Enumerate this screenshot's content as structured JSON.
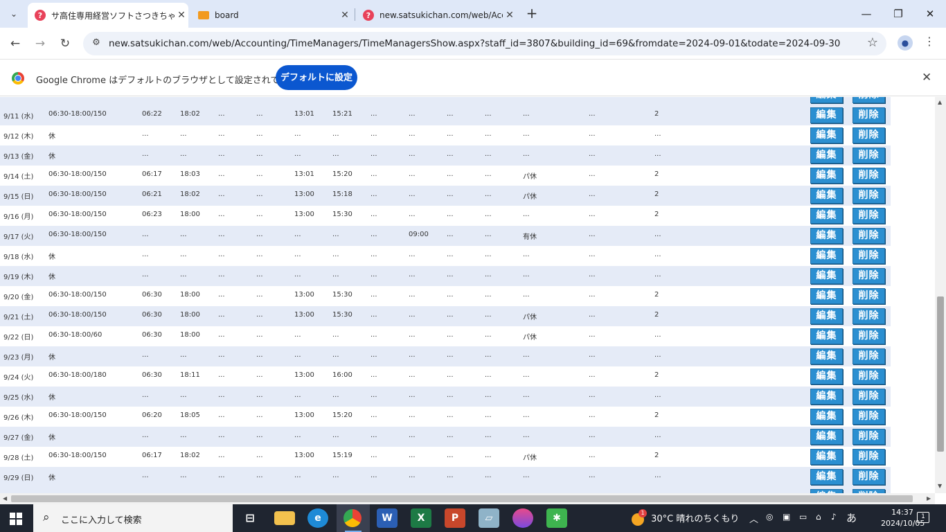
{
  "tabs": [
    {
      "title": "サ高住専用経営ソフトさつきちゃん",
      "favicon": "question-favicon",
      "active": true
    },
    {
      "title": "board",
      "favicon": "board-favicon",
      "active": false
    },
    {
      "title": "new.satsukichan.com/web/Acco",
      "favicon": "question-favicon",
      "active": false
    }
  ],
  "address_bar": {
    "url": "new.satsukichan.com/web/Accounting/TimeManagers/TimeManagersShow.aspx?staff_id=3807&building_id=69&fromdate=2024-09-01&todate=2024-09-30"
  },
  "infobar": {
    "message": "Google Chrome はデフォルトのブラウザとして設定されていません",
    "button_label": "デフォルトに設定"
  },
  "row_buttons": {
    "edit": "編集",
    "delete": "削除"
  },
  "rows": [
    {
      "date": "9/11 (水)",
      "shift": "06:30-18:00/150",
      "in": "06:22",
      "out": "18:02",
      "c4": "...",
      "c5": "...",
      "brk_out": "13:01",
      "brk_in": "15:21",
      "c8": "...",
      "c9": "...",
      "c10": "...",
      "c11": "...",
      "leave": "...",
      "c13": "...",
      "count": "2"
    },
    {
      "date": "9/12 (木)",
      "shift": "休",
      "in": "...",
      "out": "...",
      "c4": "...",
      "c5": "...",
      "brk_out": "...",
      "brk_in": "...",
      "c8": "...",
      "c9": "...",
      "c10": "...",
      "c11": "...",
      "leave": "...",
      "c13": "...",
      "count": "..."
    },
    {
      "date": "9/13 (金)",
      "shift": "休",
      "in": "...",
      "out": "...",
      "c4": "...",
      "c5": "...",
      "brk_out": "...",
      "brk_in": "...",
      "c8": "...",
      "c9": "...",
      "c10": "...",
      "c11": "...",
      "leave": "...",
      "c13": "...",
      "count": "..."
    },
    {
      "date": "9/14 (土)",
      "shift": "06:30-18:00/150",
      "in": "06:17",
      "out": "18:03",
      "c4": "...",
      "c5": "...",
      "brk_out": "13:01",
      "brk_in": "15:20",
      "c8": "...",
      "c9": "...",
      "c10": "...",
      "c11": "...",
      "leave": "パ休",
      "c13": "...",
      "count": "2"
    },
    {
      "date": "9/15 (日)",
      "shift": "06:30-18:00/150",
      "in": "06:21",
      "out": "18:02",
      "c4": "...",
      "c5": "...",
      "brk_out": "13:00",
      "brk_in": "15:18",
      "c8": "...",
      "c9": "...",
      "c10": "...",
      "c11": "...",
      "leave": "パ休",
      "c13": "...",
      "count": "2"
    },
    {
      "date": "9/16 (月)",
      "shift": "06:30-18:00/150",
      "in": "06:23",
      "out": "18:00",
      "c4": "...",
      "c5": "...",
      "brk_out": "13:00",
      "brk_in": "15:30",
      "c8": "...",
      "c9": "...",
      "c10": "...",
      "c11": "...",
      "leave": "...",
      "c13": "...",
      "count": "2"
    },
    {
      "date": "9/17 (火)",
      "shift": "06:30-18:00/150",
      "in": "...",
      "out": "...",
      "c4": "...",
      "c5": "...",
      "brk_out": "...",
      "brk_in": "...",
      "c8": "...",
      "c9": "09:00",
      "c10": "...",
      "c11": "...",
      "leave": "有休",
      "c13": "...",
      "count": "..."
    },
    {
      "date": "9/18 (水)",
      "shift": "休",
      "in": "...",
      "out": "...",
      "c4": "...",
      "c5": "...",
      "brk_out": "...",
      "brk_in": "...",
      "c8": "...",
      "c9": "...",
      "c10": "...",
      "c11": "...",
      "leave": "...",
      "c13": "...",
      "count": "..."
    },
    {
      "date": "9/19 (木)",
      "shift": "休",
      "in": "...",
      "out": "...",
      "c4": "...",
      "c5": "...",
      "brk_out": "...",
      "brk_in": "...",
      "c8": "...",
      "c9": "...",
      "c10": "...",
      "c11": "...",
      "leave": "...",
      "c13": "...",
      "count": "..."
    },
    {
      "date": "9/20 (金)",
      "shift": "06:30-18:00/150",
      "in": "06:30",
      "out": "18:00",
      "c4": "...",
      "c5": "...",
      "brk_out": "13:00",
      "brk_in": "15:30",
      "c8": "...",
      "c9": "...",
      "c10": "...",
      "c11": "...",
      "leave": "...",
      "c13": "...",
      "count": "2"
    },
    {
      "date": "9/21 (土)",
      "shift": "06:30-18:00/150",
      "in": "06:30",
      "out": "18:00",
      "c4": "...",
      "c5": "...",
      "brk_out": "13:00",
      "brk_in": "15:30",
      "c8": "...",
      "c9": "...",
      "c10": "...",
      "c11": "...",
      "leave": "パ休",
      "c13": "...",
      "count": "2"
    },
    {
      "date": "9/22 (日)",
      "shift": "06:30-18:00/60",
      "in": "06:30",
      "out": "18:00",
      "c4": "...",
      "c5": "...",
      "brk_out": "...",
      "brk_in": "...",
      "c8": "...",
      "c9": "...",
      "c10": "...",
      "c11": "...",
      "leave": "パ休",
      "c13": "...",
      "count": "..."
    },
    {
      "date": "9/23 (月)",
      "shift": "休",
      "in": "...",
      "out": "...",
      "c4": "...",
      "c5": "...",
      "brk_out": "...",
      "brk_in": "...",
      "c8": "...",
      "c9": "...",
      "c10": "...",
      "c11": "...",
      "leave": "...",
      "c13": "...",
      "count": "..."
    },
    {
      "date": "9/24 (火)",
      "shift": "06:30-18:00/180",
      "in": "06:30",
      "out": "18:11",
      "c4": "...",
      "c5": "...",
      "brk_out": "13:00",
      "brk_in": "16:00",
      "c8": "...",
      "c9": "...",
      "c10": "...",
      "c11": "...",
      "leave": "...",
      "c13": "...",
      "count": "2"
    },
    {
      "date": "9/25 (水)",
      "shift": "休",
      "in": "...",
      "out": "...",
      "c4": "...",
      "c5": "...",
      "brk_out": "...",
      "brk_in": "...",
      "c8": "...",
      "c9": "...",
      "c10": "...",
      "c11": "...",
      "leave": "...",
      "c13": "...",
      "count": "..."
    },
    {
      "date": "9/26 (木)",
      "shift": "06:30-18:00/150",
      "in": "06:20",
      "out": "18:05",
      "c4": "...",
      "c5": "...",
      "brk_out": "13:00",
      "brk_in": "15:20",
      "c8": "...",
      "c9": "...",
      "c10": "...",
      "c11": "...",
      "leave": "...",
      "c13": "...",
      "count": "2"
    },
    {
      "date": "9/27 (金)",
      "shift": "休",
      "in": "...",
      "out": "...",
      "c4": "...",
      "c5": "...",
      "brk_out": "...",
      "brk_in": "...",
      "c8": "...",
      "c9": "...",
      "c10": "...",
      "c11": "...",
      "leave": "...",
      "c13": "...",
      "count": "..."
    },
    {
      "date": "9/28 (土)",
      "shift": "06:30-18:00/150",
      "in": "06:17",
      "out": "18:02",
      "c4": "...",
      "c5": "...",
      "brk_out": "13:00",
      "brk_in": "15:19",
      "c8": "...",
      "c9": "...",
      "c10": "...",
      "c11": "...",
      "leave": "パ休",
      "c13": "...",
      "count": "2"
    },
    {
      "date": "9/29 (日)",
      "shift": "休",
      "in": "...",
      "out": "...",
      "c4": "...",
      "c5": "...",
      "brk_out": "...",
      "brk_in": "...",
      "c8": "...",
      "c9": "...",
      "c10": "...",
      "c11": "...",
      "leave": "...",
      "c13": "...",
      "count": "..."
    }
  ],
  "taskbar": {
    "search_placeholder": "ここに入力して検索",
    "weather": "30°C 晴れのちくもり",
    "weather_badge": "1",
    "time": "14:37",
    "date": "2024/10/05",
    "ime": "あ",
    "notification_count": "1"
  },
  "colors": {
    "button_blue": "#2b8fd1",
    "row_alt": "#e5ebf7",
    "chrome_blue": "#0b57d0"
  }
}
